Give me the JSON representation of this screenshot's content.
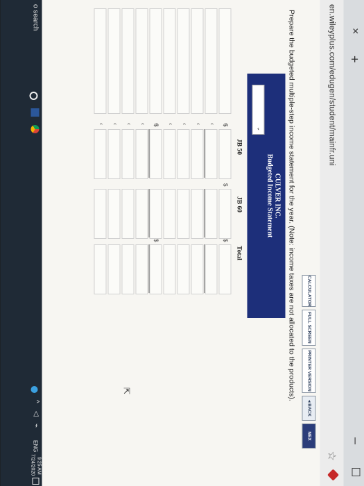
{
  "browser": {
    "tab_close": "×",
    "tab_new": "+",
    "minimize": "–",
    "url": "en.wileyplus.com/edugen/student/mainfr.uni"
  },
  "toolbar": {
    "calculator": "CALCULATOR",
    "full_screen": "FULL SCREEN",
    "printer_version": "PRINTER VERSION",
    "back": "◂ BACK",
    "next": "NEX"
  },
  "question": {
    "instruction": "Prepare the budgeted multiple-step income statement for the year. (Note: income taxes are not allocated to the products)."
  },
  "statement": {
    "company": "CULVER INC.",
    "title": "Budgeted Income Statement",
    "period_caret": "⌄",
    "columns": [
      "JB 50",
      "JB 60",
      "Total"
    ],
    "dollar_sign": "$",
    "row_caret": "‹"
  },
  "taskbar": {
    "search": "o search",
    "lang": "ENG",
    "time": "9:25 AM",
    "date": "7/24/2020"
  }
}
